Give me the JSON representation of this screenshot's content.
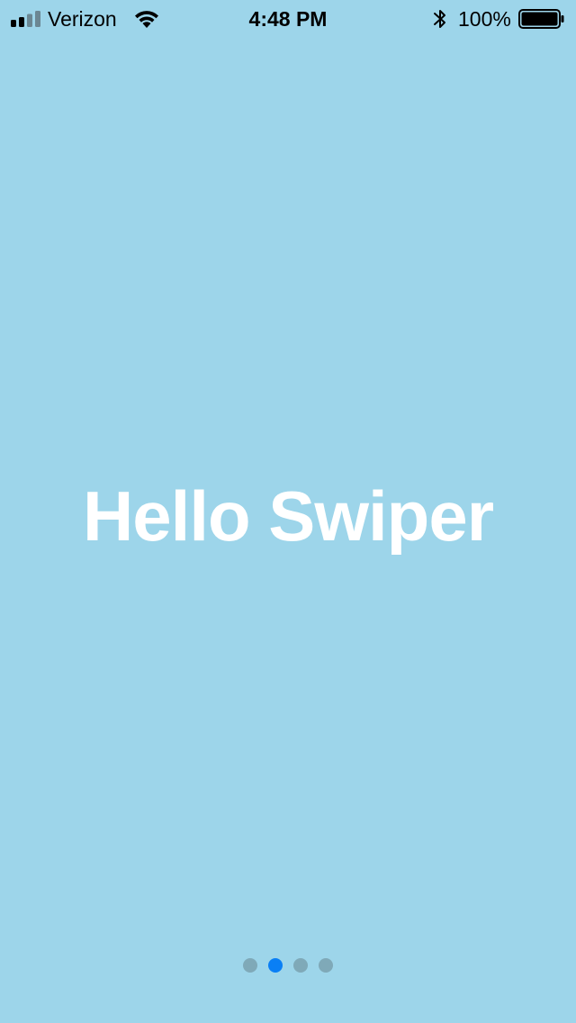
{
  "status_bar": {
    "carrier": "Verizon",
    "time": "4:48 PM",
    "battery_percent": "100%",
    "signal_bars_filled": 2,
    "signal_bars_total": 4,
    "battery_level": 1.0,
    "icons": [
      "signal-icon",
      "wifi-icon",
      "bluetooth-icon",
      "battery-icon"
    ]
  },
  "slide": {
    "title": "Hello Swiper",
    "background_color": "#9dd5ea",
    "text_color": "#ffffff"
  },
  "pagination": {
    "total": 4,
    "active_index": 1,
    "active_color": "#0a7ff5",
    "inactive_color": "#7fa9b8"
  }
}
